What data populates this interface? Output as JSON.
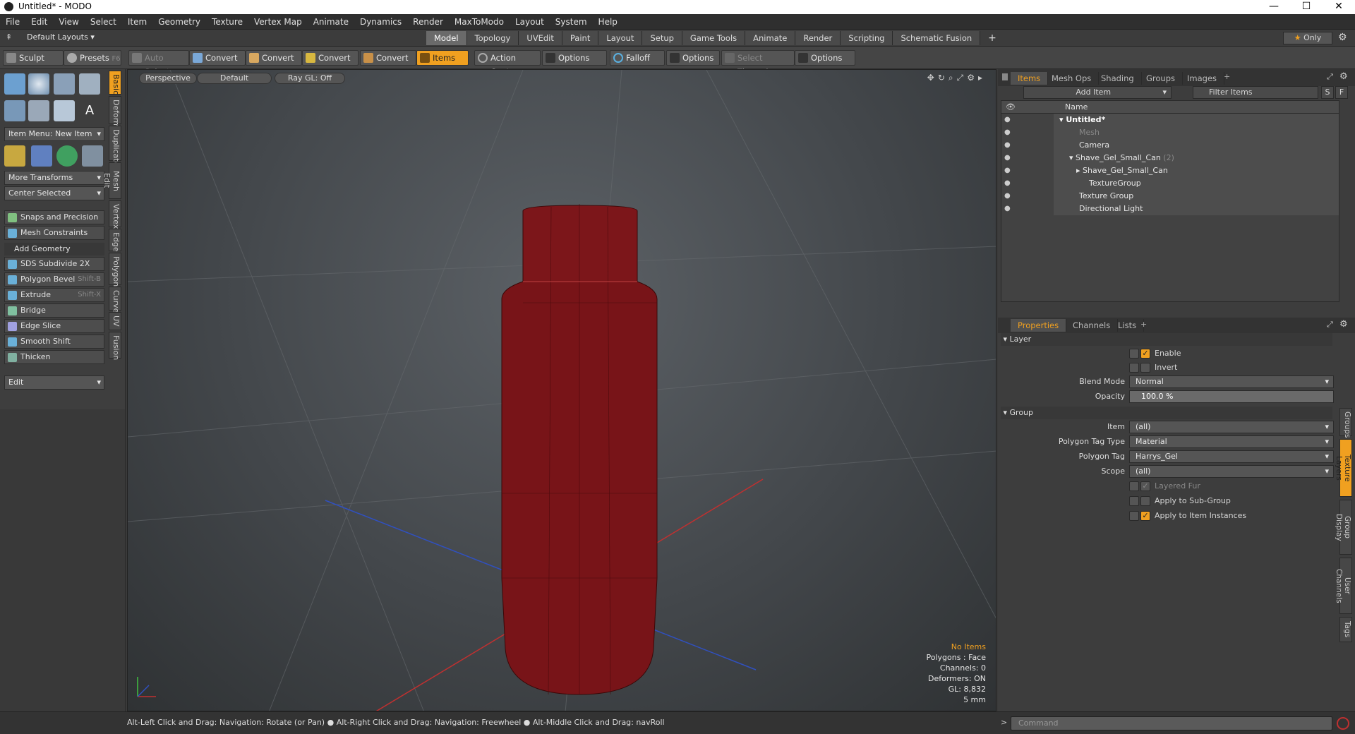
{
  "window": {
    "title": "Untitled* - MODO",
    "min": "—",
    "max": "☐",
    "close": "✕"
  },
  "menu": [
    "File",
    "Edit",
    "View",
    "Select",
    "Item",
    "Geometry",
    "Texture",
    "Vertex Map",
    "Animate",
    "Dynamics",
    "Render",
    "MaxToModo",
    "Layout",
    "System",
    "Help"
  ],
  "layoutbar": {
    "layout_select": "Default Layouts",
    "tabs": [
      "Model",
      "Topology",
      "UVEdit",
      "Paint",
      "Layout",
      "Setup",
      "Game Tools",
      "Animate",
      "Render",
      "Scripting",
      "Schematic Fusion"
    ],
    "add": "+",
    "only": "Only"
  },
  "toolbar": {
    "sculpt": "Sculpt",
    "presets": "Presets",
    "presets_shortcut": "F6",
    "auto_select": "Auto Select",
    "convert": "Convert",
    "items": "Items",
    "action_center": "Action Center",
    "options": "Options",
    "falloff": "Falloff",
    "select_through": "Select Through"
  },
  "left": {
    "item_menu": "Item Menu: New Item",
    "more_transforms": "More Transforms",
    "center_selected": "Center Selected",
    "snaps": "Snaps and Precision",
    "mesh_constraints": "Mesh Constraints",
    "add_geometry": "Add Geometry",
    "tools": [
      {
        "label": "SDS Subdivide 2X",
        "shortcut": ""
      },
      {
        "label": "Polygon Bevel",
        "shortcut": "Shift-B"
      },
      {
        "label": "Extrude",
        "shortcut": "Shift-X"
      },
      {
        "label": "Bridge",
        "shortcut": ""
      },
      {
        "label": "Edge Slice",
        "shortcut": ""
      },
      {
        "label": "Smooth Shift",
        "shortcut": ""
      },
      {
        "label": "Thicken",
        "shortcut": ""
      }
    ],
    "edit": "Edit",
    "vtabs": [
      "Basic",
      "Deform",
      "Duplicate",
      "Mesh Edit",
      "Vertex",
      "Edge",
      "Polygon",
      "Curve",
      "UV",
      "Fusion"
    ]
  },
  "viewport": {
    "view": "Perspective",
    "shading": "Default",
    "raygl": "Ray GL: Off",
    "info": {
      "selection": "No Items",
      "polygons": "Polygons : Face",
      "channels": "Channels: 0",
      "deformers": "Deformers: ON",
      "gl": "GL: 8,832",
      "scale": "5 mm"
    },
    "colors": {
      "object": "#7a1418",
      "x_axis": "#c03030",
      "z_axis": "#3050c0"
    }
  },
  "items_panel": {
    "tabs": [
      "Items",
      "Mesh Ops",
      "Shading",
      "Groups",
      "Images"
    ],
    "add_item": "Add Item",
    "filter": "Filter Items",
    "s": "S",
    "f": "F",
    "name_col": "Name",
    "tree": [
      {
        "label": "Untitled*",
        "count": ""
      },
      {
        "label": "Mesh",
        "count": ""
      },
      {
        "label": "Camera",
        "count": ""
      },
      {
        "label": "Shave_Gel_Small_Can",
        "count": "(2)"
      },
      {
        "label": "Shave_Gel_Small_Can",
        "count": ""
      },
      {
        "label": "TextureGroup",
        "count": ""
      },
      {
        "label": "Texture Group",
        "count": ""
      },
      {
        "label": "Directional Light",
        "count": ""
      }
    ]
  },
  "properties": {
    "tabs": [
      "Properties",
      "Channels",
      "Lists"
    ],
    "layer_section": "Layer",
    "enable": "Enable",
    "invert": "Invert",
    "blend_mode_label": "Blend Mode",
    "blend_mode": "Normal",
    "opacity_label": "Opacity",
    "opacity": "100.0 %",
    "group_section": "Group",
    "item_label": "Item",
    "item": "(all)",
    "ptt_label": "Polygon Tag Type",
    "ptt": "Material",
    "pt_label": "Polygon Tag",
    "pt": "Harrys_Gel",
    "scope_label": "Scope",
    "scope": "(all)",
    "layered_fur": "Layered Fur",
    "apply_sub": "Apply to Sub-Group",
    "apply_inst": "Apply to Item Instances",
    "side_tabs": [
      "Groups",
      "Texture Layers",
      "Group Display",
      "User Channels",
      "Tags"
    ]
  },
  "status": {
    "hint": "Alt-Left Click and Drag: Navigation: Rotate (or Pan) ● Alt-Right Click and Drag: Navigation: Freewheel ● Alt-Middle Click and Drag: navRoll",
    "command": "Command"
  }
}
